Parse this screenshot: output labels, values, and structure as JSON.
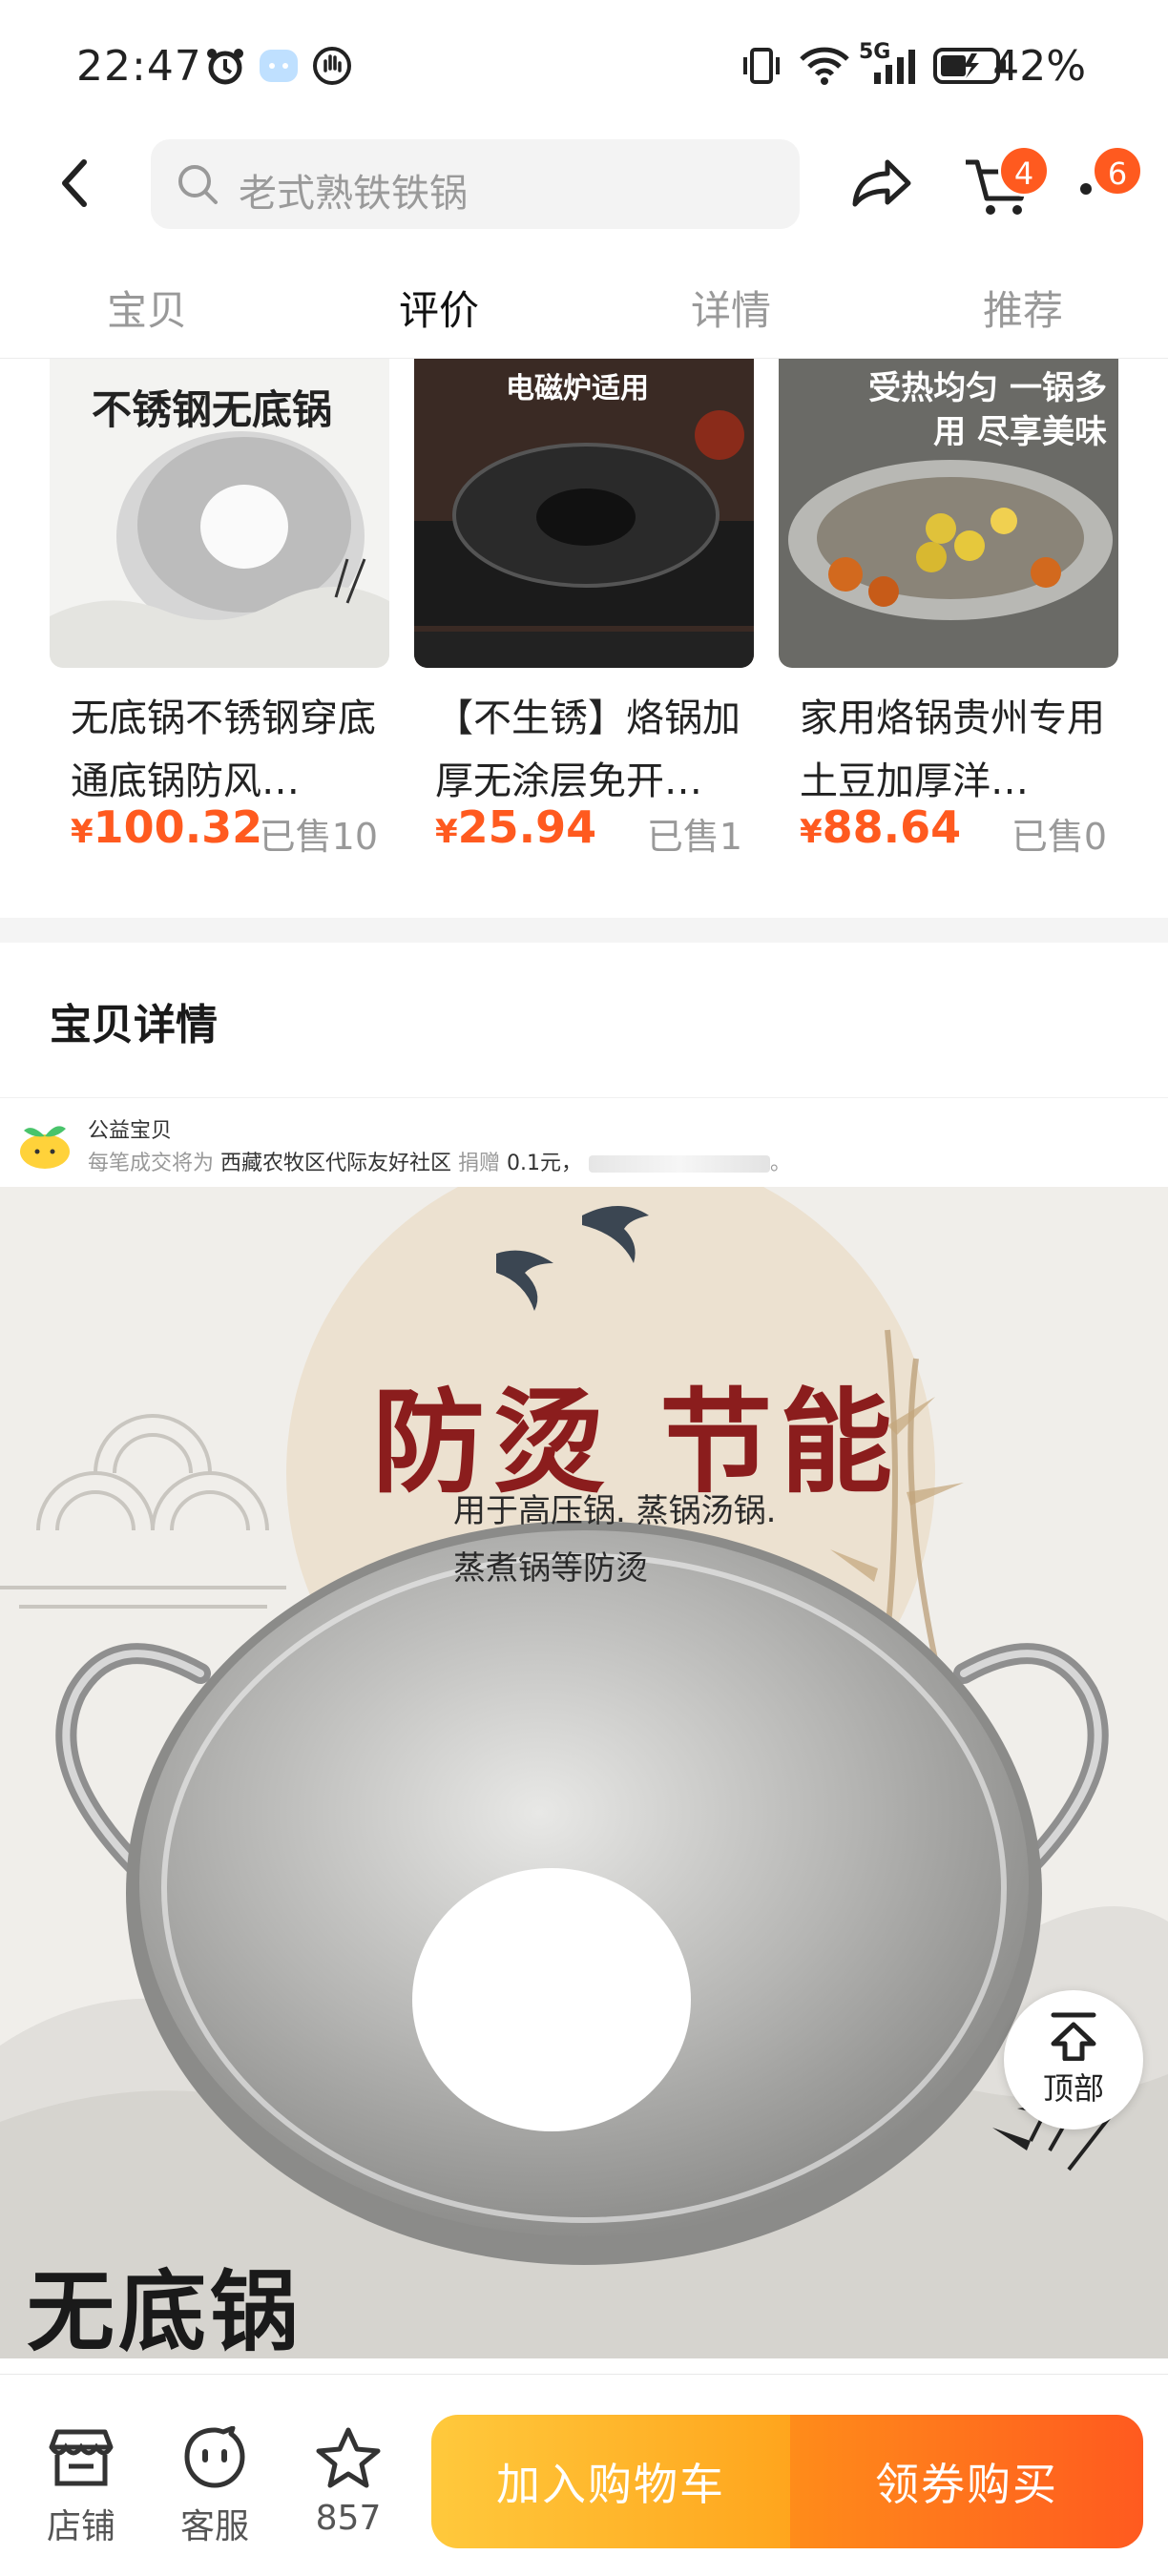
{
  "status_bar": {
    "time": "22:47",
    "network": "5G",
    "battery": "42%"
  },
  "header": {
    "search_placeholder": "老式熟铁铁锅",
    "cart_count": "4",
    "message_count": "6"
  },
  "tabs": [
    {
      "label": "宝贝"
    },
    {
      "label": "评价"
    },
    {
      "label": "详情"
    },
    {
      "label": "推荐"
    }
  ],
  "recommendations": [
    {
      "image_caption": "不锈钢无底锅",
      "title": "无底锅不锈钢穿底通底锅防风…",
      "price": "100.32",
      "sold": "已售10"
    },
    {
      "image_caption": "电磁炉适用",
      "title": "【不生锈】烙锅加厚无涂层免开…",
      "price": "25.94",
      "sold": "已售1"
    },
    {
      "image_caption": "受热均匀 一锅多用 尽享美味",
      "title": "家用烙锅贵州专用土豆加厚洋…",
      "price": "88.64",
      "sold": "已售0"
    }
  ],
  "detail_section": {
    "title": "宝贝详情"
  },
  "charity": {
    "title": "公益宝贝",
    "prefix": "每笔成交将为",
    "org": "西藏农牧区代际友好社区",
    "donate": "捐赠",
    "amount": "0.1元，",
    "suffix": "。"
  },
  "banner": {
    "headline": "防烫 节能",
    "line1": "用于高压锅. 蒸锅汤锅.",
    "line2": "蒸煮锅等防烫",
    "brand": "无底锅"
  },
  "back_to_top_label": "顶部",
  "bottom_bar": {
    "shop_label": "店铺",
    "service_label": "客服",
    "favorites_count": "857",
    "add_to_cart": "加入购物车",
    "buy_now": "领券购买"
  },
  "colors": {
    "accent": "#ff5a1f",
    "cart_button": "#ffb52b",
    "buy_button": "#ff7a1f"
  }
}
